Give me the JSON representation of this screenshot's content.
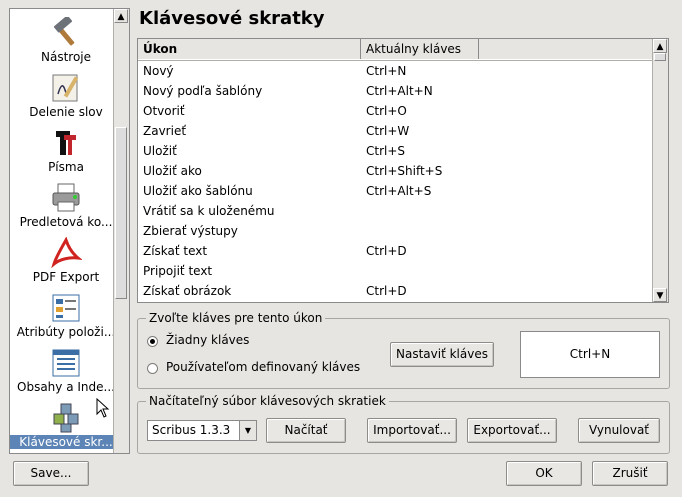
{
  "sidebar": {
    "items": [
      {
        "label": "Nástroje",
        "icon": "hammer-icon"
      },
      {
        "label": "Delenie slov",
        "icon": "hyphenation-icon"
      },
      {
        "label": "Písma",
        "icon": "fonts-icon"
      },
      {
        "label": "Predletová ko...",
        "icon": "preflight-icon"
      },
      {
        "label": "PDF Export",
        "icon": "pdf-icon"
      },
      {
        "label": "Atribúty položi...",
        "icon": "attributes-icon"
      },
      {
        "label": "Obsahy a Inde...",
        "icon": "toc-icon"
      },
      {
        "label": "Klávesové skr...",
        "icon": "keyboard-shortcuts-icon"
      }
    ]
  },
  "page": {
    "title": "Klávesové skratky"
  },
  "table": {
    "headers": [
      "Úkon",
      "Aktuálny kláves"
    ],
    "rows": [
      {
        "action": "Nový",
        "key": "Ctrl+N"
      },
      {
        "action": "Nový podľa šablóny",
        "key": "Ctrl+Alt+N"
      },
      {
        "action": "Otvoriť",
        "key": "Ctrl+O"
      },
      {
        "action": "Zavrieť",
        "key": "Ctrl+W"
      },
      {
        "action": "Uložiť",
        "key": "Ctrl+S"
      },
      {
        "action": "Uložiť ako",
        "key": "Ctrl+Shift+S"
      },
      {
        "action": "Uložiť ako šablónu",
        "key": "Ctrl+Alt+S"
      },
      {
        "action": "Vrátiť sa k uloženému",
        "key": ""
      },
      {
        "action": "Zbierať výstupy",
        "key": ""
      },
      {
        "action": "Získať text",
        "key": "Ctrl+D"
      },
      {
        "action": "Pripojiť text",
        "key": ""
      },
      {
        "action": "Získať obrázok",
        "key": "Ctrl+D"
      }
    ]
  },
  "key_group": {
    "legend": "Zvoľte kláves pre tento úkon",
    "radio_none": "Žiadny kláves",
    "radio_user": "Používateľom definovaný kláves",
    "set_key_button": "Nastaviť kláves",
    "current_key": "Ctrl+N"
  },
  "file_group": {
    "legend": "Načítateľný súbor klávesových skratiek",
    "select_value": "Scribus 1.3.3",
    "load_button": "Načítať",
    "import_button": "Importovať...",
    "export_button": "Exportovať...",
    "reset_button": "Vynulovať"
  },
  "footer": {
    "save_button": "Save...",
    "ok_button": "OK",
    "cancel_button": "Zrušiť"
  }
}
